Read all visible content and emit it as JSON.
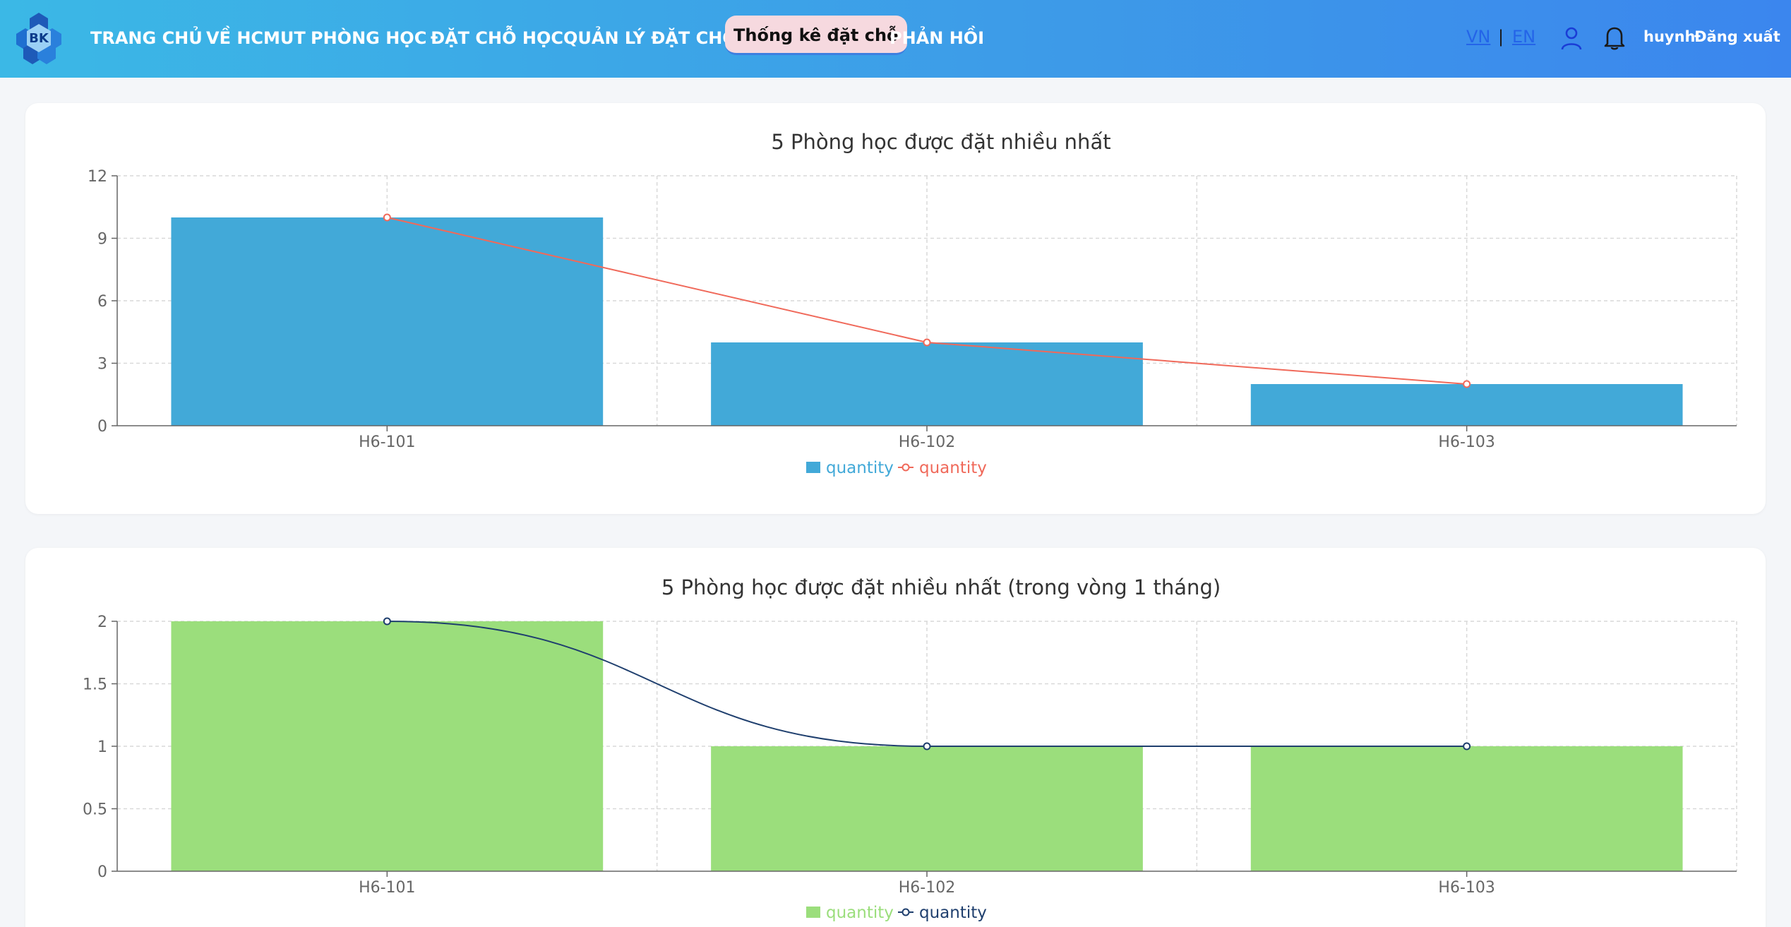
{
  "header": {
    "logo_text": "BK",
    "nav": [
      {
        "label": "TRANG CHỦ"
      },
      {
        "label": "VỀ HCMUT"
      },
      {
        "label": "PHÒNG HỌC"
      },
      {
        "label": "ĐẶT CHỖ HỌC"
      },
      {
        "label": "QUẢN LÝ ĐẶT CHỖ"
      },
      {
        "label": "Thống kê đặt chỗ",
        "active": true
      },
      {
        "label": "PHẢN HỒI"
      }
    ],
    "lang_vn": "VN",
    "lang_sep": "|",
    "lang_en": "EN",
    "username": "huynh",
    "logout": "Đăng xuất",
    "icons": [
      "user-icon",
      "bell-icon"
    ]
  },
  "chart_data": [
    {
      "type": "bar",
      "title": "5 Phòng học được đặt nhiều nhất",
      "categories": [
        "H6-101",
        "H6-102",
        "H6-103"
      ],
      "series": [
        {
          "name": "quantity",
          "type": "bar",
          "values": [
            10,
            4,
            2
          ],
          "color": "#42a9d8"
        },
        {
          "name": "quantity",
          "type": "line",
          "values": [
            10,
            4,
            2
          ],
          "color": "#f0695a",
          "smooth": false
        }
      ],
      "yticks": [
        0,
        3,
        6,
        9,
        12
      ],
      "ylim": [
        0,
        12
      ],
      "grid": true,
      "legend": "bottom-center"
    },
    {
      "type": "bar",
      "title": "5 Phòng học được đặt nhiều nhất (trong vòng 1 tháng)",
      "categories": [
        "H6-101",
        "H6-102",
        "H6-103"
      ],
      "series": [
        {
          "name": "quantity",
          "type": "bar",
          "values": [
            2,
            1,
            1
          ],
          "color": "#9bde7c"
        },
        {
          "name": "quantity",
          "type": "line",
          "values": [
            2,
            1,
            1
          ],
          "color": "#1f3f6e",
          "smooth": true
        }
      ],
      "yticks": [
        0,
        0.5,
        1,
        1.5,
        2
      ],
      "ylim": [
        0,
        2
      ],
      "grid": true,
      "legend": "bottom-center"
    }
  ]
}
